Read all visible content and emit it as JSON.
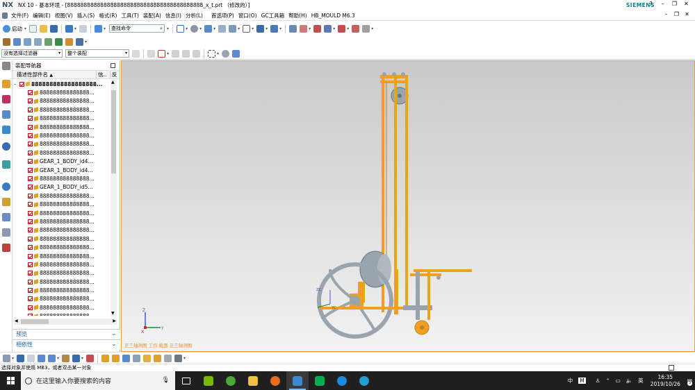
{
  "window": {
    "logo": "NX",
    "title": "NX 10 - 基本环境 - [88888888888888888888888888888888888888888_x_t.prt （修改的）]",
    "brand": "SIEMENS",
    "controls": [
      "?",
      "–",
      "❐",
      "✕"
    ],
    "sub_controls": [
      "–",
      "❐",
      "✕"
    ]
  },
  "menu": {
    "items": [
      "文件(F)",
      "编辑(E)",
      "视图(V)",
      "插入(S)",
      "格式(R)",
      "工具(T)",
      "装配(A)",
      "信息(I)",
      "分析(L)",
      "首选项(P)",
      "窗口(O)",
      "GC工具箱",
      "帮助(H)",
      "HB_MOULD M6.3"
    ]
  },
  "toolbar": {
    "start_label": "启动",
    "search_placeholder": "查找命令",
    "filter_selected": "没有选择过滤器",
    "assembly_selected": "整个装配"
  },
  "navigator": {
    "title": "装配导航器",
    "col_name": "描述性部件名",
    "col_info": "信..",
    "col_extra": "反",
    "root": "888888888888888888...",
    "items": [
      "888888888888888...",
      "888888888888888...",
      "888888888888888...",
      "888888888888888...",
      "888888888888888...",
      "888888888888888...",
      "888888888888888...",
      "888888888888888...",
      "GEAR_1_BODY_id4...",
      "GEAR_1_BODY_id4...",
      "888888888888888...",
      "GEAR_1_BODY_id5...",
      "888888888888888...",
      "888888888888888...",
      "888888888888888...",
      "888888888888888...",
      "888888888888888...",
      "888888888888888...",
      "888888888888888...",
      "888888888888888...",
      "888888888888888...",
      "888888888888888...",
      "888888888888888...",
      "888888888888888...",
      "888888888888888...",
      "888888888888888...",
      "888888888888888...",
      "888888888888888..."
    ],
    "panel_preview": "预览",
    "panel_dependency": "相依性"
  },
  "viewport": {
    "overlay_label": "正三轴测图 工作 截面 正三轴测图",
    "axis_z": "Z",
    "axis_y": "Y",
    "axis_x": "X",
    "csys_z": "ZC",
    "csys_y": "YC"
  },
  "status": {
    "message": "选择对象并使用 MB3，或者双击某一对象"
  },
  "taskbar": {
    "search_placeholder": "在这里输入你要搜索的内容",
    "tray_lang": "中",
    "tray_ime": "M",
    "time": "16:35",
    "date": "2019/10/26",
    "notification_count": "3"
  },
  "colors": {
    "model_orange": "#f0a020",
    "model_gray": "#9aa4ae",
    "brand_teal": "#0f7d8c",
    "panel_blue": "#1b5fa8",
    "taskbar": "#1f1f1f"
  }
}
